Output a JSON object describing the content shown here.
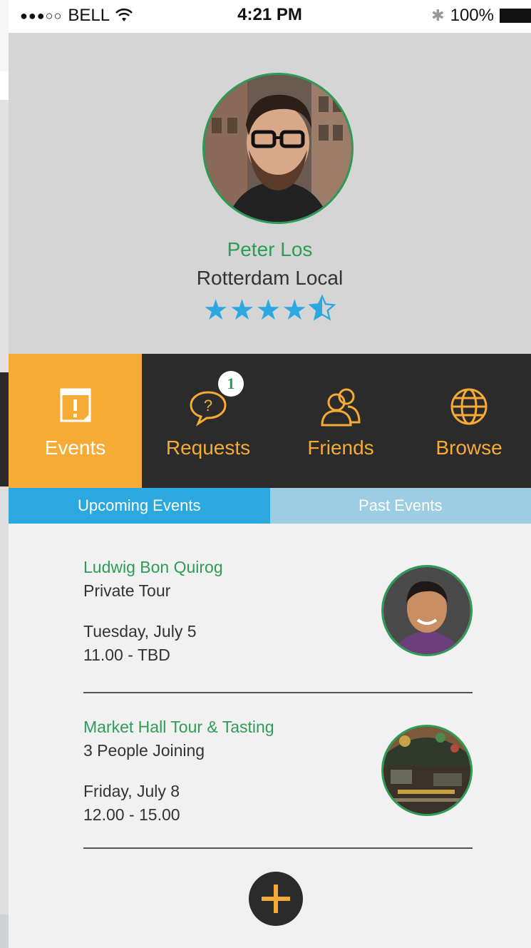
{
  "status_bar": {
    "carrier": "BELL",
    "signal": "●●●○○",
    "time": "4:21 PM",
    "battery": "100%"
  },
  "profile": {
    "name": "Peter Los",
    "role": "Rotterdam Local",
    "rating": 4.5,
    "max_rating": 5
  },
  "nav": {
    "tabs": [
      {
        "label": "Events",
        "icon": "calendar-alert-icon",
        "active": true
      },
      {
        "label": "Requests",
        "icon": "question-bubble-icon",
        "badge": "1"
      },
      {
        "label": "Friends",
        "icon": "friends-icon"
      },
      {
        "label": "Browse",
        "icon": "globe-icon"
      }
    ]
  },
  "subtabs": {
    "upcoming": "Upcoming Events",
    "past": "Past Events"
  },
  "events": [
    {
      "title": "Ludwig Bon Quirog",
      "subtitle": "Private Tour",
      "date": "Tuesday, July 5",
      "time": "11.00 - TBD"
    },
    {
      "title": "Market Hall Tour & Tasting",
      "subtitle": "3 People Joining",
      "date": "Friday, July 8",
      "time": "12.00 - 15.00"
    }
  ],
  "colors": {
    "accent_orange": "#f6ab37",
    "accent_green": "#2e9c57",
    "accent_blue": "#2ba8e0",
    "dark": "#2b2b2b"
  }
}
